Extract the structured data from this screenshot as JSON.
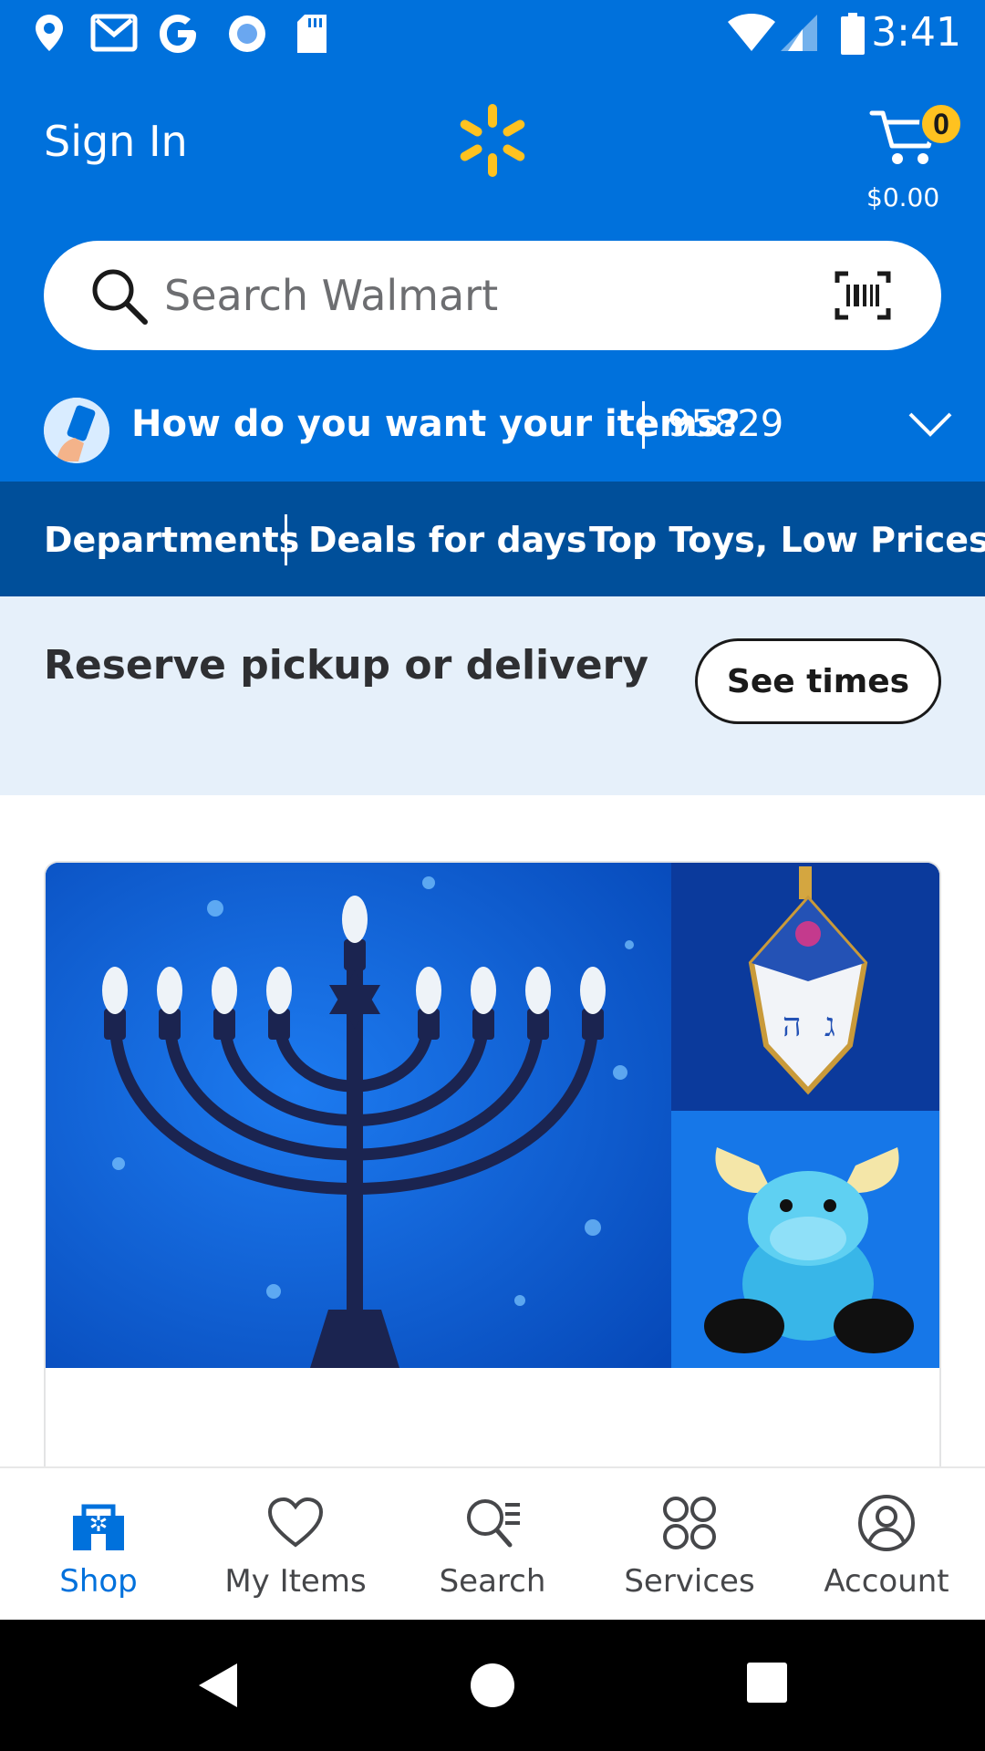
{
  "status_bar": {
    "time": "3:41",
    "icons": [
      "location-icon",
      "gmail-icon",
      "google-icon",
      "record-icon",
      "sd-card-icon",
      "wifi-icon",
      "signal-icon",
      "battery-icon"
    ]
  },
  "header": {
    "sign_in": "Sign In",
    "logo": "walmart-spark-icon",
    "cart_count": "0",
    "cart_total": "$0.00"
  },
  "search": {
    "placeholder": "Search Walmart"
  },
  "fulfillment": {
    "question": "How do you want your items?",
    "zip": "95829"
  },
  "nav_links": [
    "Departments",
    "Deals for days",
    "Top Toys, Low Prices"
  ],
  "reserve": {
    "title": "Reserve pickup or delivery",
    "button": "See times"
  },
  "bottom_nav": [
    {
      "label": "Shop",
      "icon": "shop-icon",
      "active": true
    },
    {
      "label": "My Items",
      "icon": "heart-icon",
      "active": false
    },
    {
      "label": "Search",
      "icon": "search-list-icon",
      "active": false
    },
    {
      "label": "Services",
      "icon": "services-icon",
      "active": false
    },
    {
      "label": "Account",
      "icon": "account-icon",
      "active": false
    }
  ],
  "colors": {
    "brand_blue": "#0071dc",
    "nav_blue": "#004f9a",
    "spark_yellow": "#ffc220",
    "reserve_bg": "#e6f0fa"
  }
}
